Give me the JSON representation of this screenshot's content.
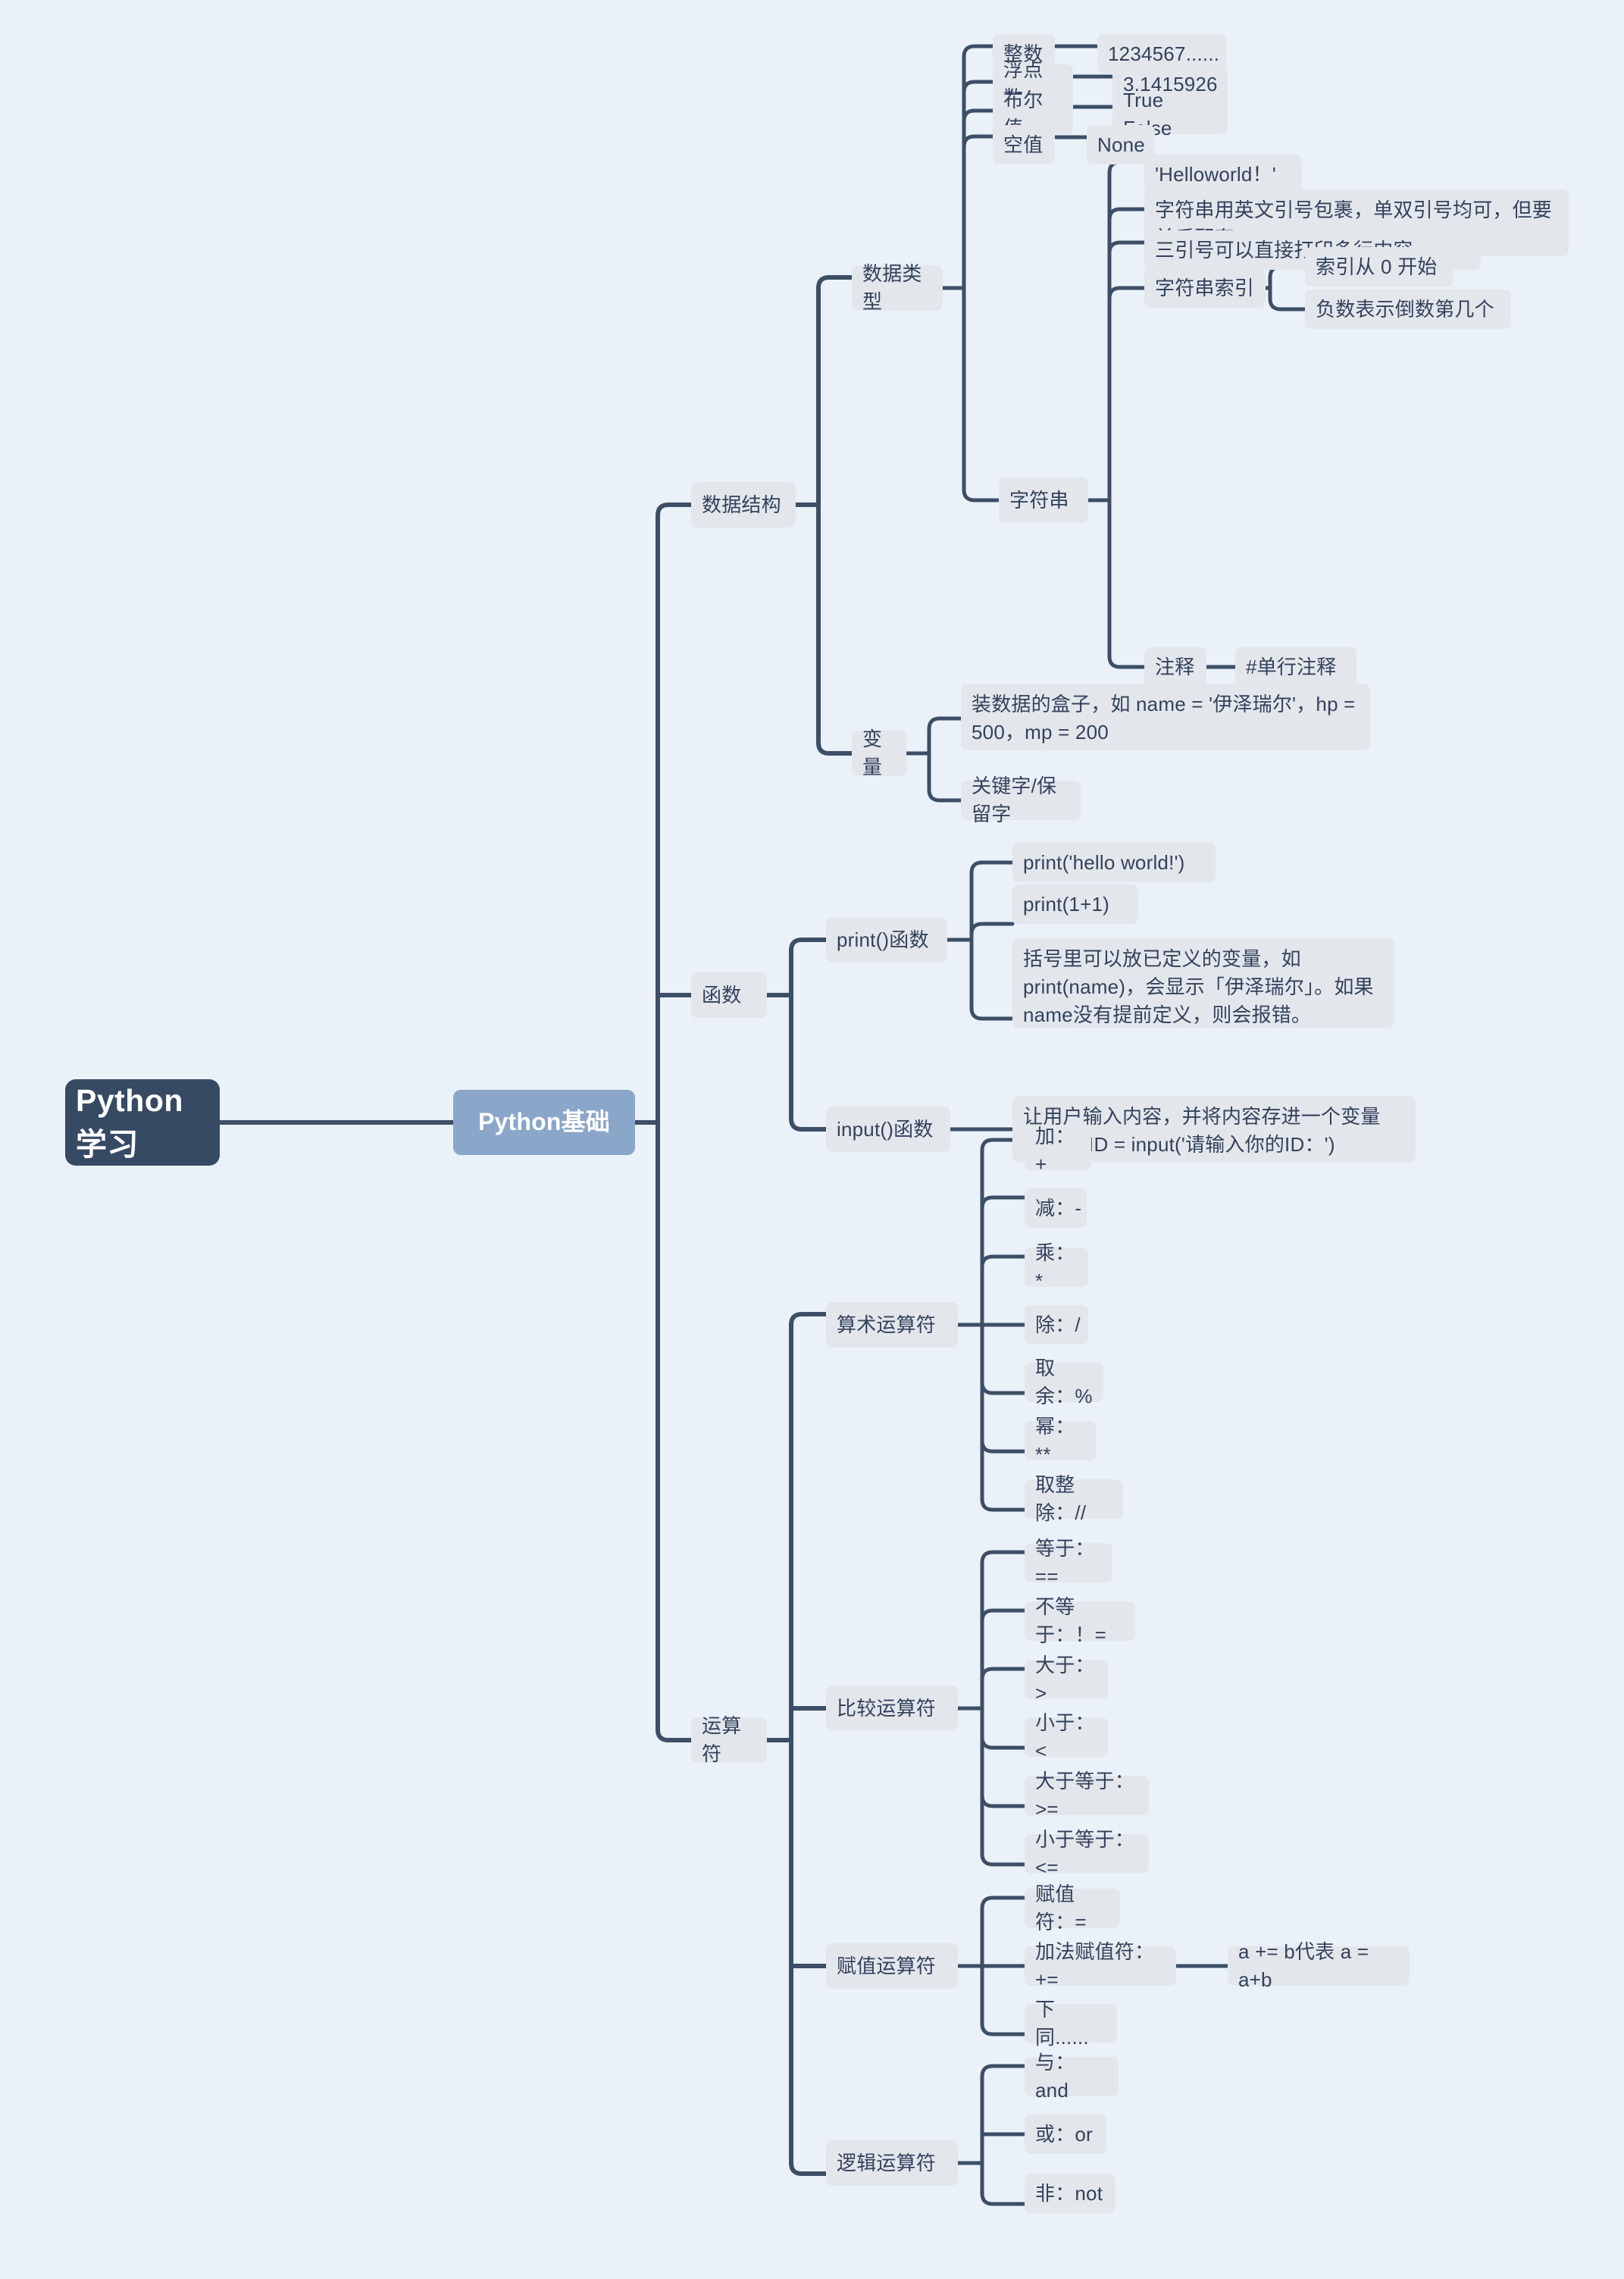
{
  "root": {
    "label": "Python 学习"
  },
  "level1": {
    "label": "Python基础"
  },
  "branches": {
    "data_structure": {
      "label": "数据结构",
      "data_types": {
        "label": "数据类型",
        "items": [
          {
            "label": "整数",
            "value": "1234567......"
          },
          {
            "label": "浮点数",
            "value": "3.1415926"
          },
          {
            "label": "布尔值",
            "value": "True False"
          },
          {
            "label": "空值",
            "value": "None"
          }
        ],
        "string": {
          "label": "字符串",
          "notes": [
            "'Helloworld！'",
            "字符串用英文引号包裹，单双引号均可，但要前后配套",
            "三引号可以直接打印多行内容"
          ],
          "index": {
            "label": "字符串索引",
            "items": [
              "索引从 0 开始",
              "负数表示倒数第几个"
            ]
          },
          "comment": {
            "label": "注释",
            "value": "#单行注释"
          }
        }
      },
      "variable": {
        "label": "变量",
        "items": [
          "装数据的盒子，如 name = '伊泽瑞尔'，hp = 500，mp = 200",
          "关键字/保留字"
        ]
      }
    },
    "function": {
      "label": "函数",
      "print": {
        "label": "print()函数",
        "items": [
          "print('hello world!')",
          "print(1+1)",
          "括号里可以放已定义的变量，如print(name)，会显示「伊泽瑞尔」。如果name没有提前定义，则会报错。"
        ]
      },
      "input": {
        "label": "input()函数",
        "items": [
          "让用户输入内容，并将内容存进一个变量内，如 ID = input('请输入你的ID：')"
        ]
      }
    },
    "operator": {
      "label": "运算符",
      "arithmetic": {
        "label": "算术运算符",
        "items": [
          "加：+",
          "减：-",
          "乘：*",
          "除：/",
          "取余：%",
          "幂：**",
          "取整除：//"
        ]
      },
      "comparison": {
        "label": "比较运算符",
        "items": [
          "等于：==",
          "不等于：！=",
          "大于：>",
          "小于：<",
          "大于等于：>=",
          "小于等于：<="
        ]
      },
      "assignment": {
        "label": "赋值运算符",
        "items": [
          "赋值符：=",
          "加法赋值符：+=",
          "下同......"
        ],
        "plus_equal_note": "a += b代表 a = a+b"
      },
      "logical": {
        "label": "逻辑运算符",
        "items": [
          "与：and",
          "或：or",
          "非：not"
        ]
      }
    }
  },
  "colors": {
    "background": "#eaf1f9",
    "root_bg": "#364a63",
    "level1_bg": "#8aa6c8",
    "node_bg": "#e3e7ec",
    "text": "#33415c",
    "wire": "#3c4f66"
  }
}
